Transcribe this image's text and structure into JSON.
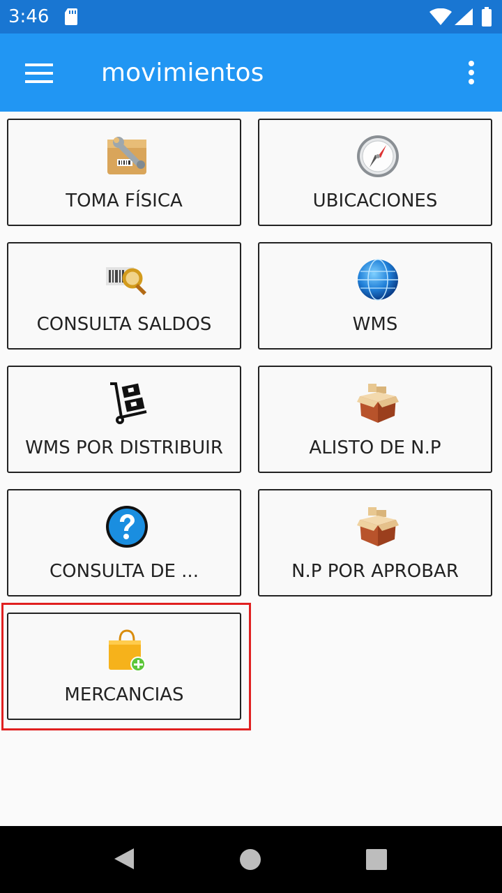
{
  "status_bar": {
    "time": "3:46",
    "icons": [
      "sd-card-icon",
      "wifi-icon",
      "signal-icon",
      "battery-icon"
    ]
  },
  "app_bar": {
    "title": "movimientos",
    "menu_icon": "hamburger-menu-icon",
    "overflow_icon": "more-vert-icon"
  },
  "tiles": [
    {
      "label": "TOMA FÍSICA",
      "icon": "toolbox-icon"
    },
    {
      "label": "UBICACIONES",
      "icon": "compass-icon"
    },
    {
      "label": "CONSULTA SALDOS",
      "icon": "barcode-search-icon"
    },
    {
      "label": "WMS",
      "icon": "globe-icon"
    },
    {
      "label": "WMS POR DISTRIBUIR",
      "icon": "hand-truck-icon"
    },
    {
      "label": "ALISTO DE N.P",
      "icon": "open-box-icon"
    },
    {
      "label": "CONSULTA DE ...",
      "icon": "help-icon"
    },
    {
      "label": "N.P POR APROBAR",
      "icon": "open-box-icon"
    },
    {
      "label": "MERCANCIAS",
      "icon": "shopping-bag-add-icon",
      "highlighted": true
    }
  ],
  "nav_bar": {
    "icons": [
      "back-icon",
      "home-icon",
      "recents-icon"
    ]
  },
  "colors": {
    "status_bar": "#1976d2",
    "app_bar": "#2196f3",
    "highlight": "#e02020",
    "background": "#fafafa"
  }
}
